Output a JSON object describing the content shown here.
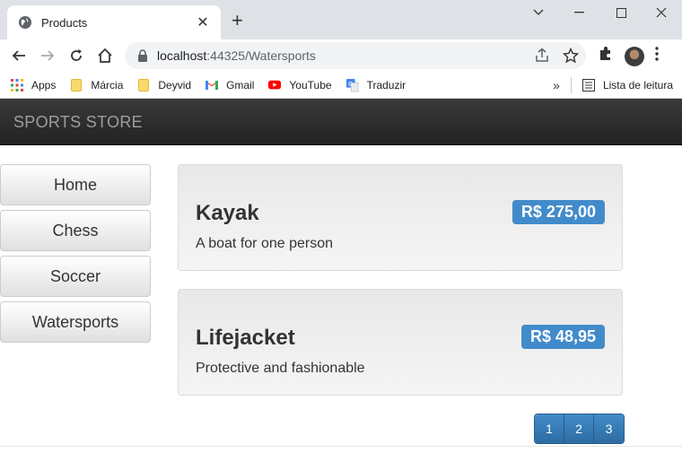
{
  "browser": {
    "tab_title": "Products",
    "url_host": "localhost",
    "url_rest": ":44325/Watersports",
    "bookmarks": [
      {
        "label": "Apps",
        "icon": "apps-grid-icon"
      },
      {
        "label": "Márcia",
        "icon": "folder-icon"
      },
      {
        "label": "Deyvid",
        "icon": "folder-icon"
      },
      {
        "label": "Gmail",
        "icon": "gmail-icon"
      },
      {
        "label": "YouTube",
        "icon": "youtube-icon"
      },
      {
        "label": "Traduzir",
        "icon": "translate-icon"
      }
    ],
    "reading_list": "Lista de leitura"
  },
  "page": {
    "brand": "SPORTS STORE",
    "categories": [
      "Home",
      "Chess",
      "Soccer",
      "Watersports"
    ],
    "products": [
      {
        "name": "Kayak",
        "description": "A boat for one person",
        "price": "R$ 275,00"
      },
      {
        "name": "Lifejacket",
        "description": "Protective and fashionable",
        "price": "R$ 48,95"
      }
    ],
    "pages": [
      "1",
      "2",
      "3"
    ]
  },
  "colors": {
    "accent": "#428bca",
    "navbar": "#2a2a2a",
    "brand_text": "#9d9d9d"
  }
}
